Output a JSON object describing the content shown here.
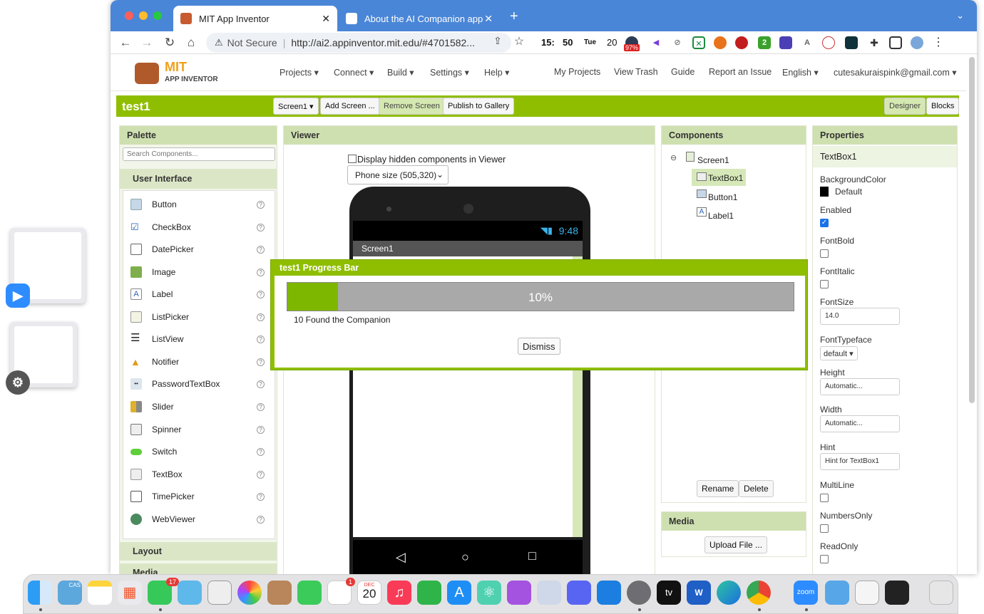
{
  "browser": {
    "tabs": [
      {
        "title": "MIT App Inventor",
        "active": true
      },
      {
        "title": "About the AI Companion app -",
        "active": false
      }
    ],
    "new_tab": "+",
    "address": {
      "security": "Not Secure",
      "url": "http://ai2.appinventor.mit.edu/#4701582..."
    },
    "clock": {
      "time_h": "15:",
      "time_m": "50",
      "day": "Tue",
      "date": "20"
    },
    "battery_badge": "97%",
    "ext_number": "2"
  },
  "app": {
    "logo_top": "MIT",
    "logo_bottom": "APP INVENTOR",
    "menus": [
      "Projects ▾",
      "Connect ▾",
      "Build ▾",
      "Settings ▾",
      "Help ▾"
    ],
    "right_links": [
      "My Projects",
      "View Trash",
      "Guide",
      "Report an Issue",
      "English ▾",
      "cutesakuraispink@gmail.com ▾"
    ],
    "project_name": "test1",
    "toolbar": {
      "screen": "Screen1 ▾",
      "add_screen": "Add Screen ...",
      "remove_screen": "Remove Screen",
      "publish": "Publish to Gallery",
      "designer": "Designer",
      "blocks": "Blocks"
    }
  },
  "palette": {
    "title": "Palette",
    "search_placeholder": "Search Components...",
    "category": "User Interface",
    "items": [
      "Button",
      "CheckBox",
      "DatePicker",
      "Image",
      "Label",
      "ListPicker",
      "ListView",
      "Notifier",
      "PasswordTextBox",
      "Slider",
      "Spinner",
      "Switch",
      "TextBox",
      "TimePicker",
      "WebViewer"
    ],
    "more_categories": [
      "Layout",
      "Media"
    ],
    "help_glyph": "?"
  },
  "viewer": {
    "title": "Viewer",
    "hidden_label": "Display hidden components in Viewer",
    "size_select": "Phone size (505,320)",
    "phone_time": "9:48",
    "screen_title": "Screen1"
  },
  "dialog": {
    "title": "test1 Progress Bar",
    "progress": 0.1,
    "progress_text": "10%",
    "status": "10 Found the Companion",
    "dismiss": "Dismiss"
  },
  "components": {
    "title": "Components",
    "tree": [
      "Screen1",
      "TextBox1",
      "Button1",
      "Label1"
    ],
    "rename": "Rename",
    "delete": "Delete",
    "media_title": "Media",
    "upload": "Upload File ..."
  },
  "properties": {
    "title": "Properties",
    "selected": "TextBox1",
    "bg_label": "BackgroundColor",
    "bg_value": "Default",
    "enabled_label": "Enabled",
    "fontbold_label": "FontBold",
    "fontitalic_label": "FontItalic",
    "fontsize_label": "FontSize",
    "fontsize_value": "14.0",
    "typeface_label": "FontTypeface",
    "typeface_value": "default ▾",
    "height_label": "Height",
    "height_value": "Automatic...",
    "width_label": "Width",
    "width_value": "Automatic...",
    "hint_label": "Hint",
    "hint_value": "Hint for TextBox1",
    "multiline_label": "MultiLine",
    "numbersonly_label": "NumbersOnly",
    "readonly_label": "ReadOnly"
  },
  "dock": {
    "calendar_month": "DEC",
    "calendar_day": "20",
    "messages_badge": "17",
    "reminders_badge": "1",
    "cas_label": "CAS",
    "tv_label": "tv",
    "word_label": "W",
    "zoom_label": "zoom"
  },
  "colors": {
    "accent": "#8fbe00",
    "header": "#cfe0b0",
    "tabbar": "#4a86d7"
  }
}
